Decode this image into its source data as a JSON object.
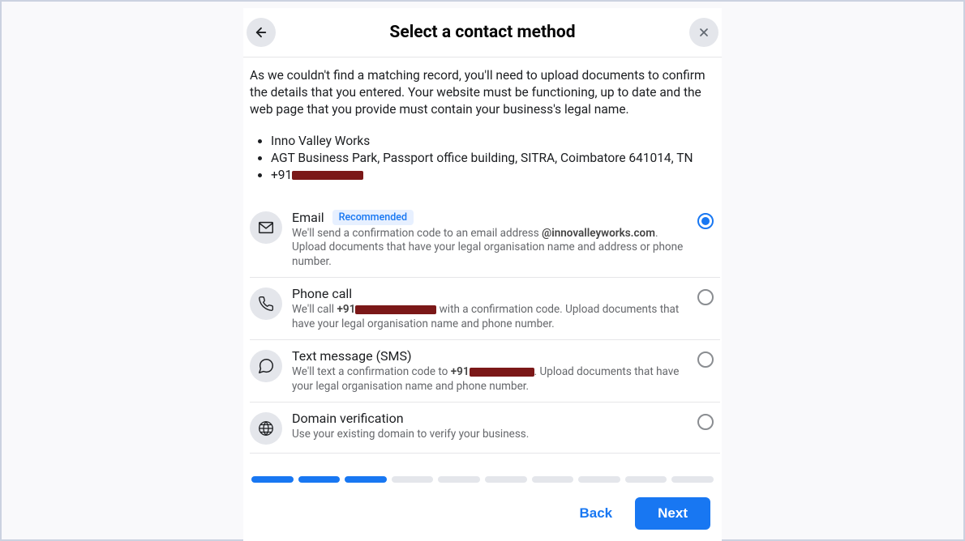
{
  "header": {
    "title": "Select a contact method"
  },
  "intro": "As we couldn't find a matching record, you'll need to upload documents to confirm the details that you entered. Your website must be functioning, up to date and the web page that you provide must contain your business's legal name.",
  "details": {
    "business_name": "Inno Valley Works",
    "address": "AGT Business Park, Passport office building, SITRA, Coimbatore 641014, TN",
    "phone_prefix": "+91"
  },
  "options": {
    "email": {
      "title": "Email",
      "recommended_label": "Recommended",
      "desc_prefix": "We'll send a confirmation code to an email address ",
      "domain": "@innovalleyworks.com",
      "desc_suffix": ". Upload documents that have your legal organisation name and address or phone number."
    },
    "phone": {
      "title": "Phone call",
      "desc_prefix": "We'll call ",
      "number_prefix": "+91",
      "desc_suffix": " with a confirmation code. Upload documents that have your legal organisation name and phone number."
    },
    "sms": {
      "title": "Text message (SMS)",
      "desc_prefix": "We'll text a confirmation code to ",
      "number_prefix": "+91",
      "desc_suffix": ". Upload documents that have your legal organisation name and phone number."
    },
    "domain": {
      "title": "Domain verification",
      "desc": "Use your existing domain to verify your business."
    }
  },
  "progress": {
    "total": 10,
    "completed": 3
  },
  "footer": {
    "back_label": "Back",
    "next_label": "Next"
  }
}
